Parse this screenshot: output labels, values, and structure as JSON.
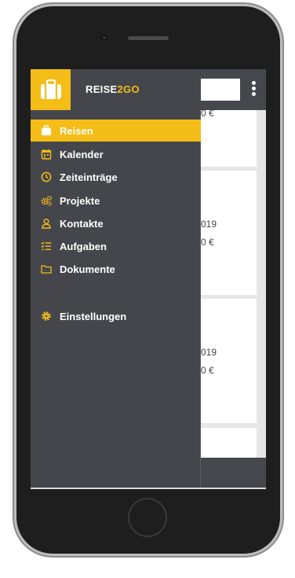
{
  "brand": {
    "part1": "REISE",
    "part2": "2GO",
    "logo_icon": "suitcase-icon"
  },
  "colors": {
    "accent": "#f5bd17",
    "drawer_bg": "#45464b",
    "header_bg": "#46474c"
  },
  "nav": {
    "items": [
      {
        "label": "Reisen",
        "icon": "suitcase-icon",
        "active": true
      },
      {
        "label": "Kalender",
        "icon": "calendar-icon"
      },
      {
        "label": "Zeiteinträge",
        "icon": "clock-icon"
      },
      {
        "label": "Projekte",
        "icon": "gears-icon"
      },
      {
        "label": "Kontakte",
        "icon": "person-icon"
      },
      {
        "label": "Aufgaben",
        "icon": "checklist-icon"
      },
      {
        "label": "Dokumente",
        "icon": "folder-icon"
      }
    ],
    "settings": {
      "label": "Einstellungen",
      "icon": "gear-icon"
    }
  },
  "background_cards": [
    {
      "line1": "0 €"
    },
    {
      "line1": "019",
      "line2": "0 €"
    },
    {
      "line1": "019",
      "line2": "0 €"
    }
  ]
}
